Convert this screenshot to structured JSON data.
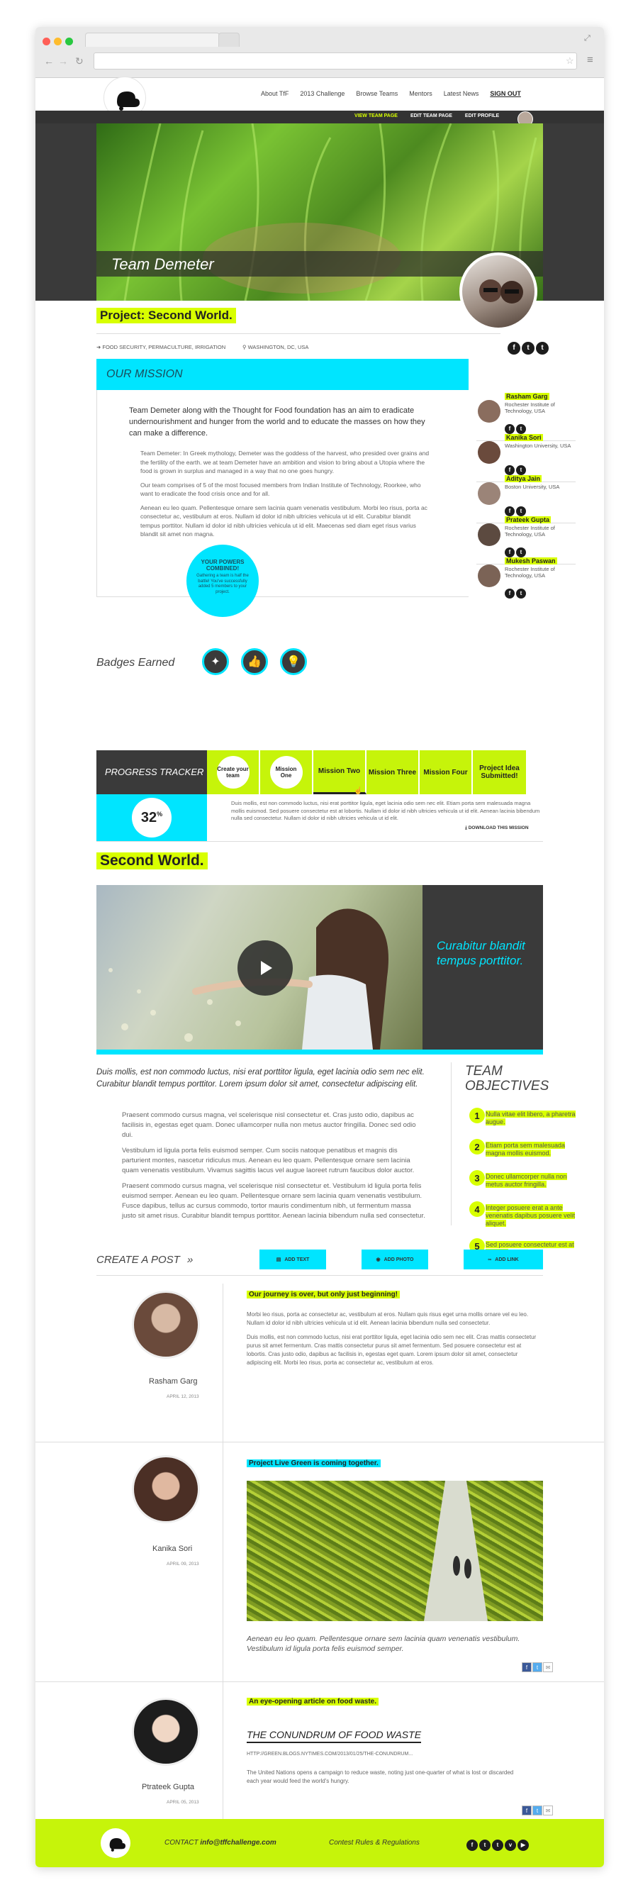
{
  "nav": {
    "about": "About TfF",
    "challenge": "2013 Challenge",
    "browse": "Browse Teams",
    "mentors": "Mentors",
    "news": "Latest News",
    "signout": "SIGN OUT"
  },
  "subnav": {
    "view": "VIEW TEAM PAGE",
    "edit_team": "EDIT TEAM PAGE",
    "edit_profile": "EDIT PROFILE"
  },
  "team": {
    "name": "Team Demeter",
    "project": "Project: Second World.",
    "category": "FOOD SECURITY, PERMACULTURE, IRRIGATION",
    "location": "WASHINGTON, DC, USA"
  },
  "mission": {
    "heading": "OUR MISSION",
    "lead": "Team Demeter along with the Thought for Food foundation has an aim to eradicate undernourishment and hunger from the world and to educate the masses on how they can make a difference.",
    "p1": "Team Demeter: In Greek mythology, Demeter was the goddess of the harvest, who presided over grains and the fertility of the earth. we at team Demeter have an ambition and vision to bring about a Utopia where the food is grown in surplus and managed in a way that no one goes hungry.",
    "p2": "Our team comprises of 5 of the most focused members from Indian Institute of Technology, Roorkee, who want to eradicate the food crisis once and for all.",
    "p3": "Aenean eu leo quam. Pellentesque ornare sem lacinia quam venenatis vestibulum. Morbi leo risus, porta ac consectetur ac, vestibulum at eros. Nullam id dolor id nibh ultricies vehicula ut id elit. Curabitur blandit tempus porttitor. Nullam id dolor id nibh ultricies vehicula ut id elit. Maecenas sed diam eget risus varius blandit sit amet non magna."
  },
  "tooltip": {
    "title": "YOUR POWERS COMBINED!",
    "body": "Gathering a team is half the battle! You've successfully added 5 members to your project."
  },
  "members": [
    {
      "name": "Rasham Garg",
      "school": "Rochester Institute of Technology, USA"
    },
    {
      "name": "Kanika Sori",
      "school": "Washington University, USA"
    },
    {
      "name": "Aditya Jain",
      "school": "Boston University, USA"
    },
    {
      "name": "Prateek Gupta",
      "school": "Rochester Institute of Technology, USA"
    },
    {
      "name": "Mukesh Paswan",
      "school": "Rochester Institute of Technology, USA"
    }
  ],
  "badges": {
    "heading": "Badges Earned"
  },
  "progress": {
    "heading": "PROGRESS TRACKER",
    "percent": "32",
    "percent_sign": "%",
    "percent_value": 32,
    "missions": [
      "Create your team",
      "Mission One",
      "Mission Two",
      "Mission Three",
      "Mission Four",
      "Project Idea Submitted!"
    ],
    "text": "Duis mollis, est non commodo luctus, nisi erat porttitor ligula, eget lacinia odio sem nec elit. Etiam porta sem malesuada magna mollis euismod. Sed posuere consectetur est at lobortis. Nullam id dolor id nibh ultricies vehicula ut id elit. Aenean lacinia bibendum nulla sed consectetur. Nullam id dolor id nibh ultricies vehicula ut id elit.",
    "download": "DOWNLOAD THIS MISSION"
  },
  "second": {
    "heading": "Second World.",
    "video_caption": "Curabitur blandit tempus porttitor.",
    "lead": "Duis mollis, est non commodo luctus, nisi erat porttitor ligula, eget lacinia odio sem nec elit. Curabitur blandit tempus porttitor. Lorem ipsum dolor sit amet, consectetur adipiscing elit.",
    "p1": "Praesent commodo cursus magna, vel scelerisque nisl consectetur et. Cras justo odio, dapibus ac facilisis in, egestas eget quam. Donec ullamcorper nulla non metus auctor fringilla. Donec sed odio dui.",
    "p2": "Vestibulum id ligula porta felis euismod semper. Cum sociis natoque penatibus et magnis dis parturient montes, nascetur ridiculus mus. Aenean eu leo quam. Pellentesque ornare sem lacinia quam venenatis vestibulum. Vivamus sagittis lacus vel augue laoreet rutrum faucibus dolor auctor.",
    "p3": "Praesent commodo cursus magna, vel scelerisque nisl consectetur et. Vestibulum id ligula porta felis euismod semper. Aenean eu leo quam. Pellentesque ornare sem lacinia quam venenatis vestibulum. Fusce dapibus, tellus ac cursus commodo, tortor mauris condimentum nibh, ut fermentum massa justo sit amet risus. Curabitur blandit tempus porttitor. Aenean lacinia bibendum nulla sed consectetur."
  },
  "objectives": {
    "heading1": "TEAM",
    "heading2": "OBJECTIVES",
    "items": [
      "Nulla vitae elit libero, a pharetra augue.",
      "Etiam porta sem malesuada magna mollis euismod.",
      "Donec ullamcorper nulla non metus auctor fringilla.",
      "Integer posuere erat a ante venenatis dapibus posuere velit aliquet.",
      "Sed posuere consectetur est at lobortis."
    ]
  },
  "create": {
    "heading": "CREATE A POST",
    "arrow": "»",
    "add_text": "ADD TEXT",
    "add_photo": "ADD PHOTO",
    "add_link": "ADD LINK"
  },
  "posts": [
    {
      "author": "Rasham Garg",
      "date": "APRIL 12, 2013",
      "title": "Our  journey is over, but only just beginning!",
      "p1": "Morbi leo risus, porta ac consectetur ac, vestibulum at eros. Nullam quis risus eget urna mollis ornare vel eu leo. Nullam id dolor id nibh ultricies vehicula ut id elit. Aenean lacinia bibendum nulla sed consectetur.",
      "p2": "Duis mollis, est non commodo luctus, nisi erat porttitor ligula, eget lacinia odio sem nec elit. Cras mattis consectetur purus sit amet fermentum. Cras mattis consectetur purus sit amet fermentum. Sed posuere consectetur est at lobortis. Cras justo odio, dapibus ac facilisis in, egestas eget quam. Lorem ipsum dolor sit amet, consectetur adipiscing elit. Morbi leo risus, porta ac consectetur ac, vestibulum at eros."
    },
    {
      "author": "Kanika Sori",
      "date": "APRIL 09, 2013",
      "title": "Project Live Green is coming together.",
      "caption": "Aenean eu leo quam. Pellentesque ornare sem lacinia quam venenatis vestibulum. Vestibulum id ligula porta felis euismod semper."
    },
    {
      "author": "Ptrateek Gupta",
      "date": "APRIL 05, 2013",
      "title": "An eye-opening article on food waste.",
      "article": "THE CONUNDRUM OF FOOD WASTE",
      "url": "HTTP://GREEN.BLOGS.NYTIMES.COM/2013/01/25/THE-CONUNDRUM...",
      "body": "The United Nations opens a campaign to reduce waste, noting just one-quarter of what is lost or discarded each year would feed the world's hungry."
    }
  ],
  "footer": {
    "contact_label": "CONTACT",
    "email": "info@tffchallenge.com",
    "rules": "Contest Rules & Regulations"
  },
  "colors": {
    "lime": "#c6f40a",
    "highlight": "#d8ff00",
    "cyan": "#00e5ff",
    "dark": "#3a3a3a"
  }
}
